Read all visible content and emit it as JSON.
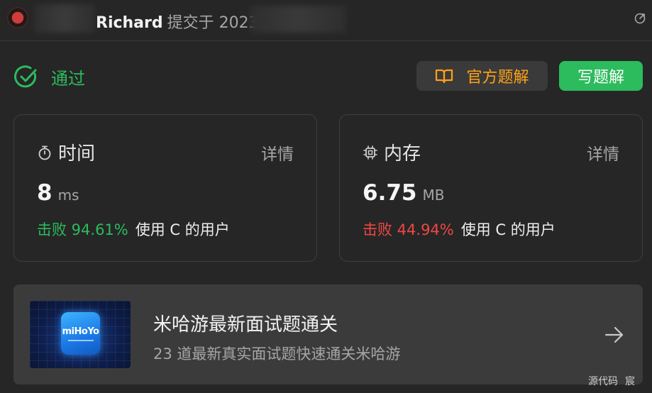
{
  "header": {
    "username": "Richard",
    "submitted_label": "提交于 2023"
  },
  "status": {
    "label": "通过",
    "color": "#2cbb5d"
  },
  "actions": {
    "official_solution_label": "官方题解",
    "write_solution_label": "写题解"
  },
  "time_card": {
    "title": "时间",
    "detail_label": "详情",
    "value": "8",
    "unit": "ms",
    "beat_label": "击败 94.61%",
    "beat_suffix": "使用 C 的用户",
    "beat_percent": 94.61
  },
  "memory_card": {
    "title": "内存",
    "detail_label": "详情",
    "value": "6.75",
    "unit": "MB",
    "beat_label": "击败 44.94%",
    "beat_suffix": "使用 C 的用户",
    "beat_percent": 44.94
  },
  "promo": {
    "thumb_logo": "miHoYo",
    "title": "米哈游最新面试题通关",
    "subtitle": "23 道最新真实面试题快速通关米哈游"
  },
  "watermark": {
    "part1": "源代码",
    "part2": "宸"
  },
  "icons": {
    "external": "external-link-icon",
    "status": "check-circle-icon",
    "book": "book-icon",
    "stopwatch": "stopwatch-icon",
    "chip": "chip-icon",
    "arrow": "arrow-right-icon"
  },
  "colors": {
    "accent_green": "#2cbb5d",
    "accent_orange": "#ffa116",
    "danger_red": "#ef4743",
    "background": "#262626"
  }
}
